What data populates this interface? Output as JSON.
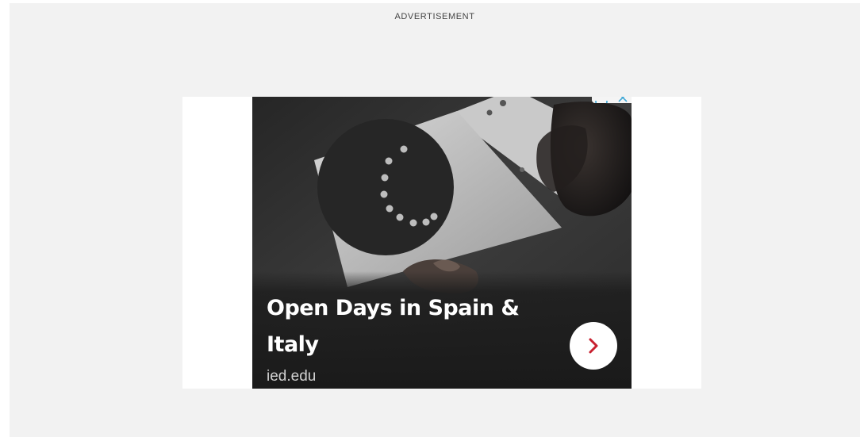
{
  "ad_label": "ADVERTISEMENT",
  "ad": {
    "headline": "Open Days in Spain & Italy",
    "domain": "ied.edu",
    "cta_icon": "chevron-right-icon",
    "adchoices_icons": [
      "info-icon",
      "close-icon"
    ]
  },
  "colors": {
    "background": "#f2f2f2",
    "slot": "#ffffff",
    "overlay": "#1e1e1e",
    "cta_arrow": "#c8202f",
    "headline": "#ffffff"
  }
}
